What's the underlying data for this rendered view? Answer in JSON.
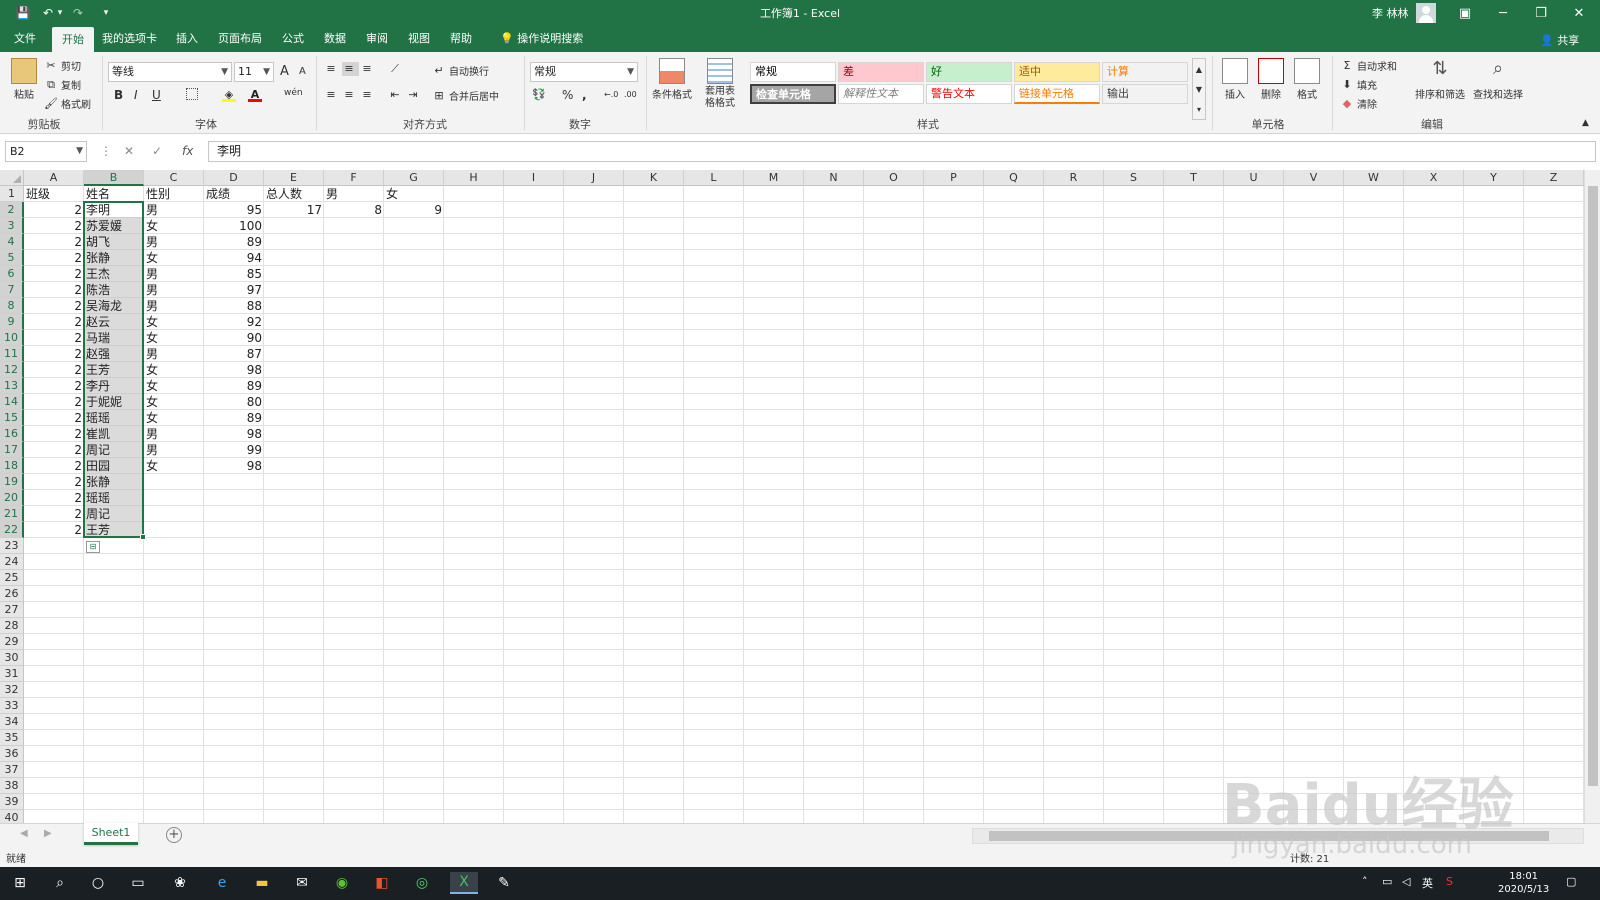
{
  "titlebar": {
    "title": "工作簿1  -  Excel",
    "user": "李 林林",
    "qa_save": "💾",
    "qa_undo": "↶",
    "qa_undo_dd": "▾",
    "qa_redo": "↷",
    "qa_more": "▾",
    "ribbon_display": "▣",
    "minimize": "─",
    "restore": "❐",
    "close": "✕"
  },
  "tabs": [
    "文件",
    "我的选项卡",
    "开始",
    "插入",
    "页面布局",
    "公式",
    "数据",
    "审阅",
    "视图",
    "帮助"
  ],
  "tab_search": "操作说明搜索",
  "share": "共享",
  "ribbon": {
    "clipboard": {
      "paste": "粘贴",
      "cut": "剪切",
      "copy": "复制",
      "format_painter": "格式刷",
      "label": "剪贴板"
    },
    "font": {
      "name": "等线",
      "size": "11",
      "bold": "B",
      "italic": "I",
      "underline": "U",
      "label": "字体",
      "grow": "A",
      "shrink": "A",
      "color_a": "A",
      "wen": "wén"
    },
    "alignment": {
      "wrap": "自动换行",
      "merge": "合并后居中",
      "label": "对齐方式"
    },
    "number": {
      "format": "常规",
      "percent": "%",
      "comma": ",",
      "label": "数字",
      "inc_dec": "←.0",
      "dec_dec": ".00"
    },
    "styles": {
      "conditional": "条件格式",
      "table": "套用表格格式",
      "label": "样式",
      "cells": [
        {
          "text": "常规",
          "bg": "#ffffff",
          "fg": "#000000"
        },
        {
          "text": "差",
          "bg": "#ffc7ce",
          "fg": "#9c0006"
        },
        {
          "text": "好",
          "bg": "#c6efce",
          "fg": "#006100"
        },
        {
          "text": "适中",
          "bg": "#ffeb9c",
          "fg": "#9c5700"
        },
        {
          "text": "计算",
          "bg": "#f2f2f2",
          "fg": "#fa7d00"
        },
        {
          "text": "检查单元格",
          "bg": "#a5a5a5",
          "fg": "#ffffff"
        },
        {
          "text": "解释性文本",
          "bg": "#ffffff",
          "fg": "#7f7f7f"
        },
        {
          "text": "警告文本",
          "bg": "#ffffff",
          "fg": "#ff0000"
        },
        {
          "text": "链接单元格",
          "bg": "#ffffff",
          "fg": "#fa7d00"
        },
        {
          "text": "输出",
          "bg": "#f2f2f2",
          "fg": "#3f3f3f"
        }
      ]
    },
    "cells": {
      "insert": "插入",
      "delete": "删除",
      "format": "格式",
      "label": "单元格"
    },
    "editing": {
      "autosum": "自动求和",
      "fill": "填充",
      "clear": "清除",
      "sort": "排序和筛选",
      "find": "查找和选择",
      "label": "编辑"
    }
  },
  "formula_bar": {
    "name_box": "B2",
    "formula": "李明",
    "cancel": "✕",
    "enter": "✓",
    "fx": "fx"
  },
  "columns": [
    "A",
    "B",
    "C",
    "D",
    "E",
    "F",
    "G",
    "H",
    "I",
    "J",
    "K",
    "L",
    "M",
    "N",
    "O",
    "P",
    "Q",
    "R",
    "S",
    "T",
    "U",
    "V",
    "W",
    "X",
    "Y",
    "Z"
  ],
  "rows": [
    "1",
    "2",
    "3",
    "4",
    "5",
    "6",
    "7",
    "8",
    "9",
    "10",
    "11",
    "12",
    "13",
    "14",
    "15",
    "16",
    "17",
    "18",
    "19",
    "20",
    "21",
    "22",
    "23",
    "24",
    "25",
    "26",
    "27",
    "28",
    "29",
    "30",
    "31",
    "32",
    "33",
    "34",
    "35",
    "36",
    "37",
    "38",
    "39",
    "40"
  ],
  "sheet": {
    "header": [
      "班级",
      "姓名",
      "性别",
      "成绩",
      "总人数",
      "男",
      "女"
    ],
    "summary": [
      "17",
      "8",
      "9"
    ],
    "data": [
      [
        "2",
        "李明",
        "男",
        "95"
      ],
      [
        "2",
        "苏爱媛",
        "女",
        "100"
      ],
      [
        "2",
        "胡飞",
        "男",
        "89"
      ],
      [
        "2",
        "张静",
        "女",
        "94"
      ],
      [
        "2",
        "王杰",
        "男",
        "85"
      ],
      [
        "2",
        "陈浩",
        "男",
        "97"
      ],
      [
        "2",
        "吴海龙",
        "男",
        "88"
      ],
      [
        "2",
        "赵云",
        "女",
        "92"
      ],
      [
        "2",
        "马瑞",
        "女",
        "90"
      ],
      [
        "2",
        "赵强",
        "男",
        "87"
      ],
      [
        "2",
        "王芳",
        "女",
        "98"
      ],
      [
        "2",
        "李丹",
        "女",
        "89"
      ],
      [
        "2",
        "于妮妮",
        "女",
        "80"
      ],
      [
        "2",
        "瑶瑶",
        "女",
        "89"
      ],
      [
        "2",
        "崔凯",
        "男",
        "98"
      ],
      [
        "2",
        "周记",
        "男",
        "99"
      ],
      [
        "2",
        "田园",
        "女",
        "98"
      ],
      [
        "2",
        "张静",
        "",
        ""
      ],
      [
        "2",
        "瑶瑶",
        "",
        ""
      ],
      [
        "2",
        "周记",
        "",
        ""
      ],
      [
        "2",
        "王芳",
        "",
        ""
      ]
    ]
  },
  "sheet_tab": "Sheet1",
  "add_sheet": "+",
  "status": {
    "ready": "就绪",
    "count": "计数: 21"
  },
  "taskbar": {
    "time": "18:01",
    "date": "2020/5/13",
    "ime": "英"
  },
  "watermark": {
    "main": "Baidu经验",
    "url": "jingyan.baidu.com"
  },
  "icons": {
    "accent": "#217346"
  }
}
